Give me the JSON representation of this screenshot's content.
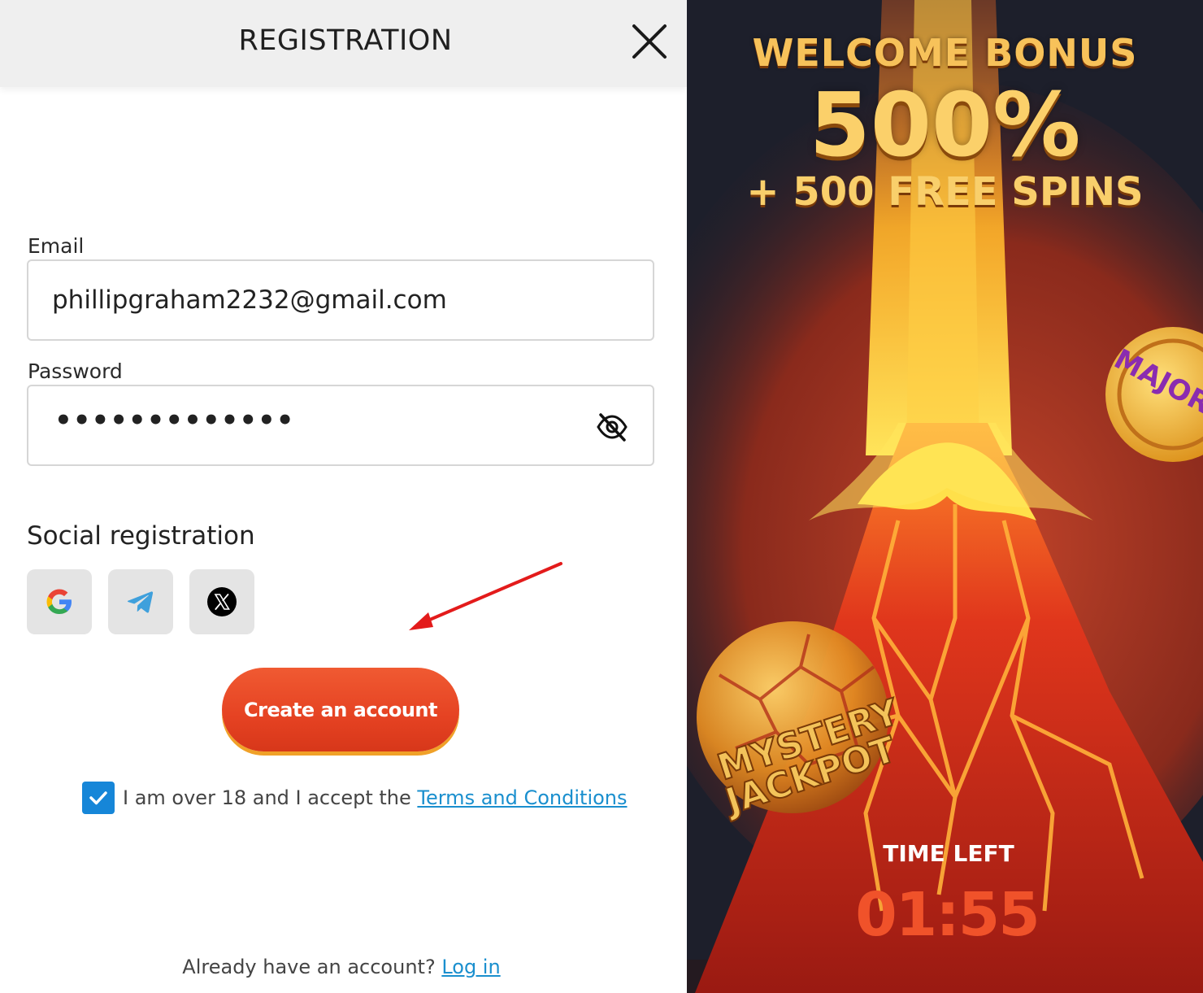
{
  "header": {
    "title": "REGISTRATION",
    "close_icon": "close-icon"
  },
  "form": {
    "email": {
      "label": "Email",
      "value": "phillipgraham2232@gmail.com"
    },
    "password": {
      "label": "Password",
      "masked_value": "•••••••••••••",
      "toggle_icon": "eye-slash-icon"
    }
  },
  "social": {
    "title": "Social registration",
    "providers": [
      "google-icon",
      "telegram-icon",
      "x-icon"
    ]
  },
  "create_button": {
    "label": "Create an account"
  },
  "terms": {
    "checked": true,
    "text": "I am over 18 and I accept the ",
    "link": "Terms and Conditions"
  },
  "login": {
    "text": "Already have an account? ",
    "link": "Log in"
  },
  "promo": {
    "welcome": "WELCOME BONUS",
    "percent": "500%",
    "spins": "+ 500 FREE SPINS",
    "badge_text": "MAJOR",
    "jackpot_line1": "MYSTERY",
    "jackpot_line2": "JACKPOT",
    "time_left_label": "TIME LEFT",
    "timer": "01:55"
  },
  "colors": {
    "accent_button": "#e54222",
    "link": "#1a8fce",
    "checkbox": "#1686d8",
    "timer": "#f0522a"
  }
}
